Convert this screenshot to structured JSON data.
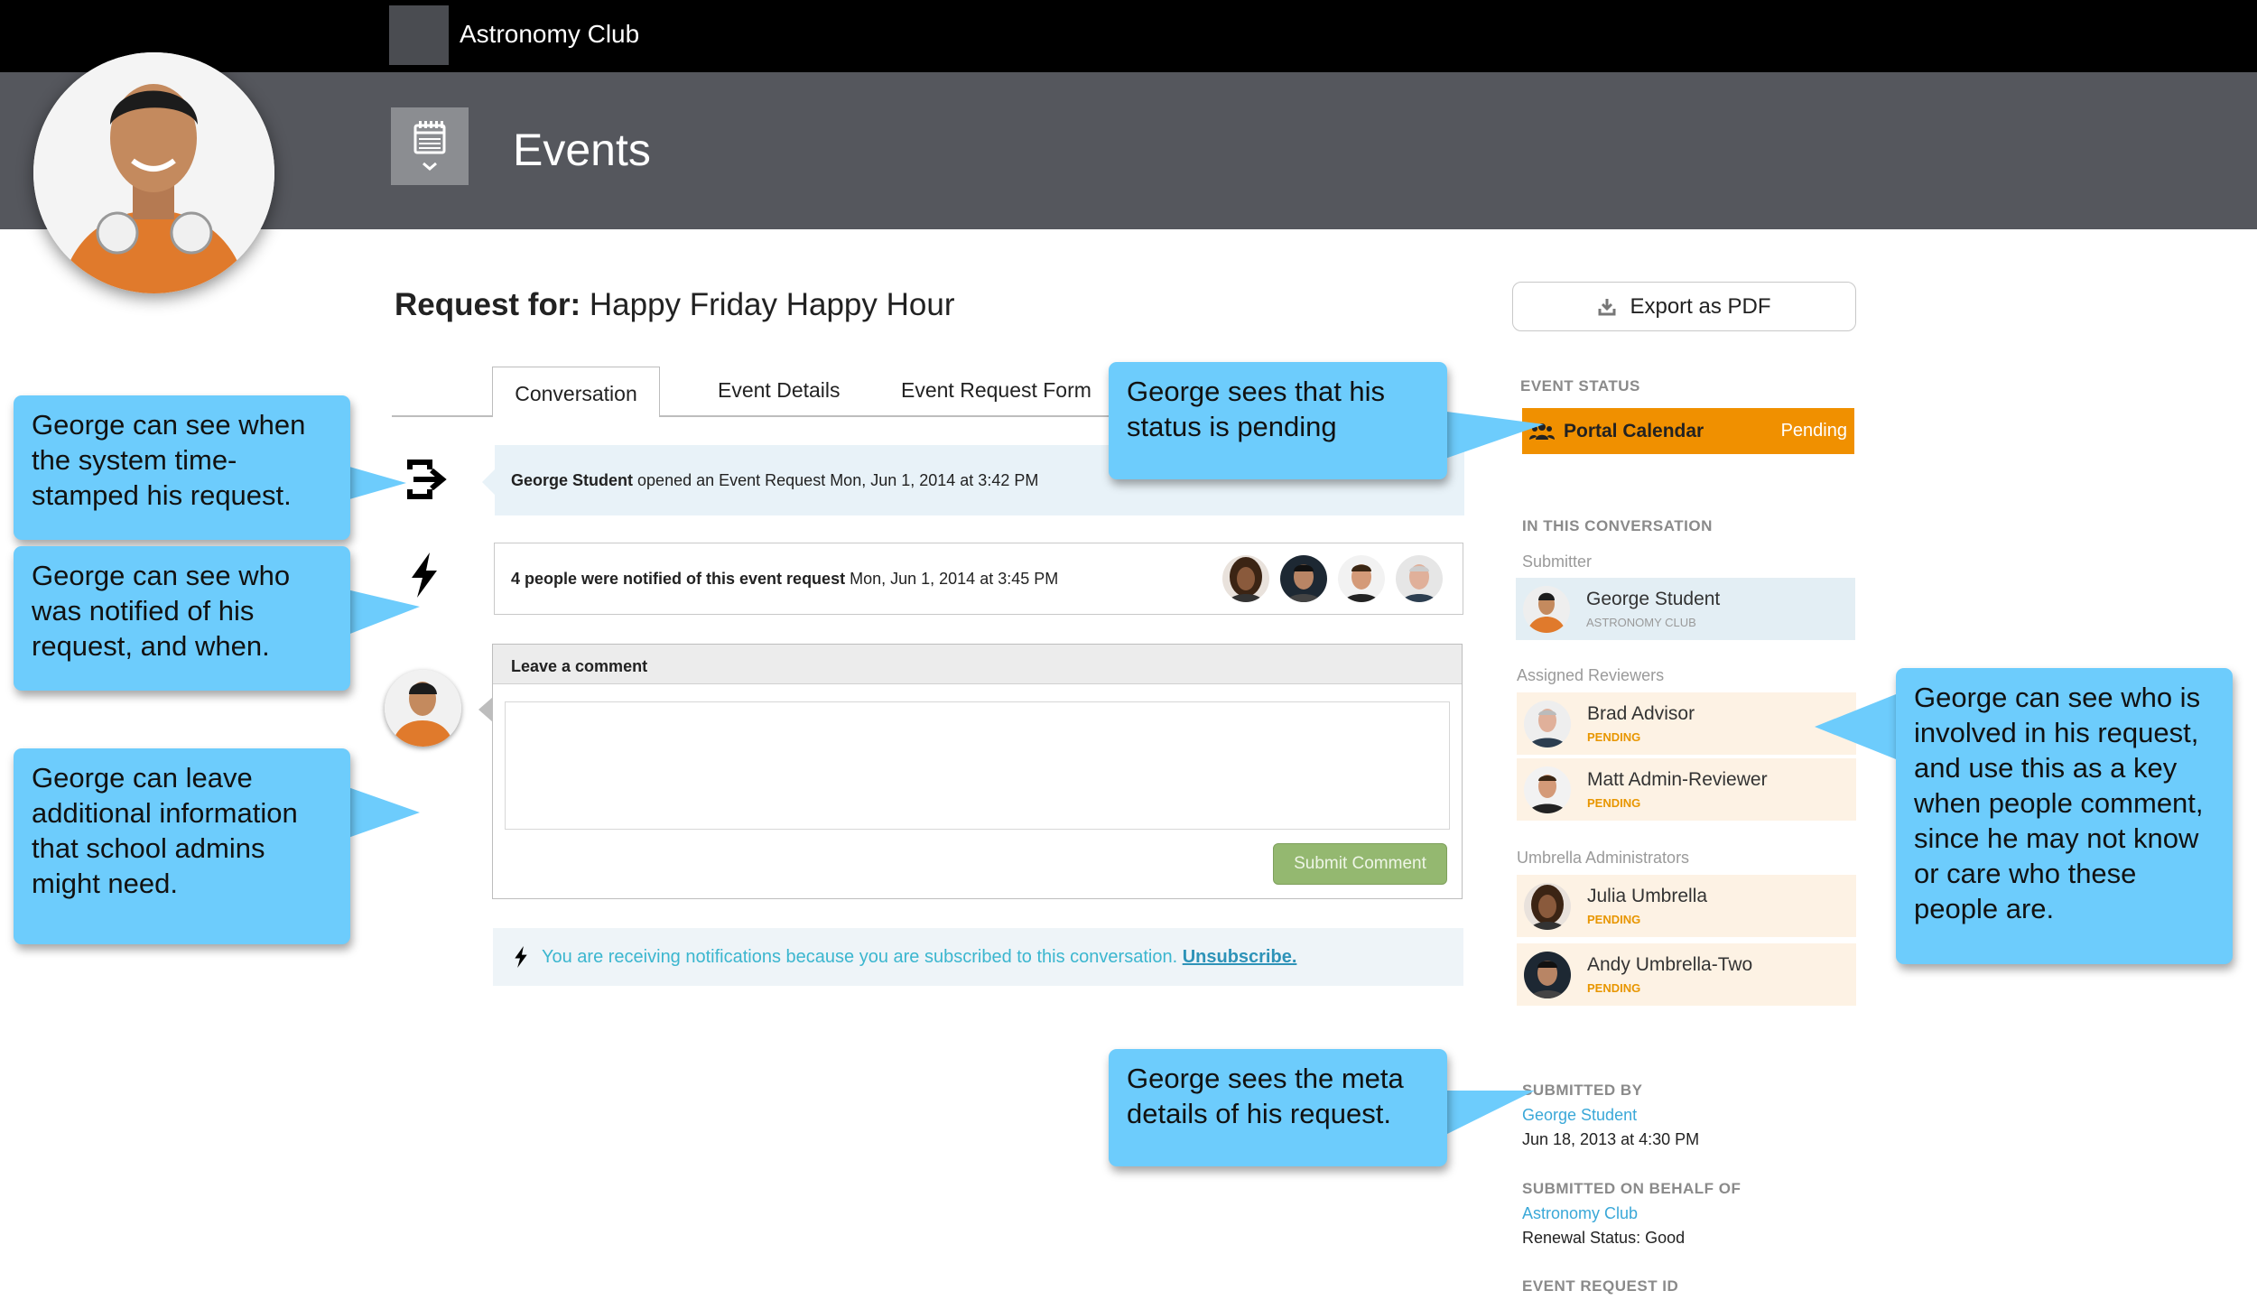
{
  "topbar": {
    "club_name": "Astronomy Club"
  },
  "header": {
    "title": "Events"
  },
  "request": {
    "label": "Request for:",
    "name": "Happy Friday Happy Hour"
  },
  "export_button": "Export as PDF",
  "tabs": [
    {
      "label": "Conversation",
      "active": true
    },
    {
      "label": "Event Details",
      "active": false
    },
    {
      "label": "Event Request Form",
      "active": false
    }
  ],
  "feed": {
    "opened": {
      "actor": "George Student",
      "text": "opened an Event Request Mon, Jun 1, 2014 at 3:42 PM"
    },
    "notified": {
      "bold": "4 people were notified of this event request",
      "text": "Mon, Jun 1, 2014 at 3:45 PM",
      "avatar_count": 4
    }
  },
  "comment": {
    "heading": "Leave a comment",
    "placeholder": "",
    "submit_label": "Submit Comment"
  },
  "notice": {
    "text": "You are receiving notifications because you are subscribed to this conversation.",
    "link": "Unsubscribe."
  },
  "sidebar": {
    "event_status_heading": "EVENT STATUS",
    "status": {
      "calendar": "Portal Calendar",
      "value": "Pending",
      "color": "#f09000"
    },
    "conversation_heading": "IN THIS CONVERSATION",
    "submitter_label": "Submitter",
    "submitter": {
      "name": "George Student",
      "caption": "ASTRONOMY CLUB"
    },
    "reviewers_label": "Assigned Reviewers",
    "reviewers": [
      {
        "name": "Brad Advisor",
        "status": "PENDING"
      },
      {
        "name": "Matt Admin-Reviewer",
        "status": "PENDING"
      }
    ],
    "admins_label": "Umbrella Administrators",
    "admins": [
      {
        "name": "Julia Umbrella",
        "status": "PENDING"
      },
      {
        "name": "Andy Umbrella-Two",
        "status": "PENDING"
      }
    ],
    "submitted_by_heading": "SUBMITTED BY",
    "submitted_by_name": "George Student",
    "submitted_by_date": "Jun 18, 2013 at 4:30 PM",
    "behalf_heading": "SUBMITTED ON BEHALF OF",
    "behalf_name": "Astronomy Club",
    "behalf_status": "Renewal Status: Good",
    "request_id_heading": "EVENT REQUEST ID"
  },
  "callouts": {
    "timestamp": "George can see when the system time-stamped his request.",
    "notified": "George can see who was notified of his request, and when.",
    "comment": "George can leave additional information that school admins might need.",
    "status": "George sees that his status is pending",
    "involved": "George can see who is involved in his request, and use this as a key when people comment, since he may not know or care who these people are.",
    "meta": "George sees the meta details of his request."
  },
  "colors": {
    "topbar": "#000000",
    "header": "#55575d",
    "callout": "#6dccfc",
    "pending": "#f09000",
    "submit": "#94b870"
  }
}
